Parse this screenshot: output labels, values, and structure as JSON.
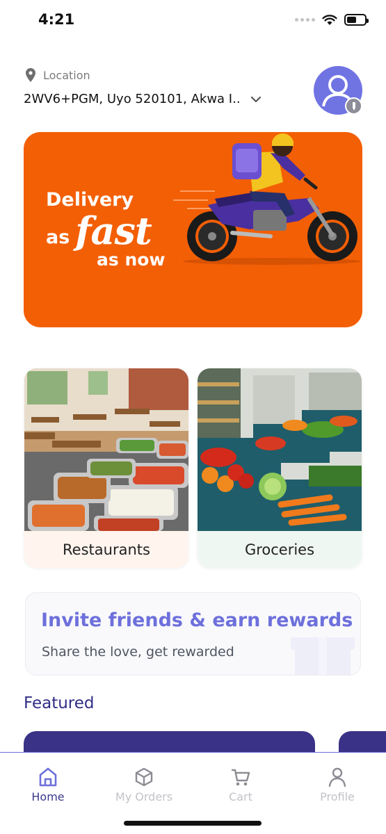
{
  "status_bar": {
    "time": "4:21"
  },
  "header": {
    "location_label": "Location",
    "location_value": "2WV6+PGM, Uyo 520101, Akwa I.."
  },
  "banner": {
    "line1": "Delivery",
    "line2_prefix": "as",
    "line2_emphasis": "fast",
    "line3": "as now"
  },
  "categories": [
    {
      "label": "Restaurants"
    },
    {
      "label": "Groceries"
    }
  ],
  "invite": {
    "title": "Invite friends & earn rewards",
    "subtitle": "Share the love, get rewarded"
  },
  "featured": {
    "title": "Featured"
  },
  "tabbar": {
    "items": [
      {
        "label": "Home",
        "icon": "home-icon",
        "active": true
      },
      {
        "label": "My Orders",
        "icon": "box-icon",
        "active": false
      },
      {
        "label": "Cart",
        "icon": "cart-icon",
        "active": false
      },
      {
        "label": "Profile",
        "icon": "person-icon",
        "active": false
      }
    ]
  },
  "colors": {
    "brand_purple": "#3a3286",
    "accent_purple": "#6d70db",
    "banner_orange": "#f35f05"
  }
}
